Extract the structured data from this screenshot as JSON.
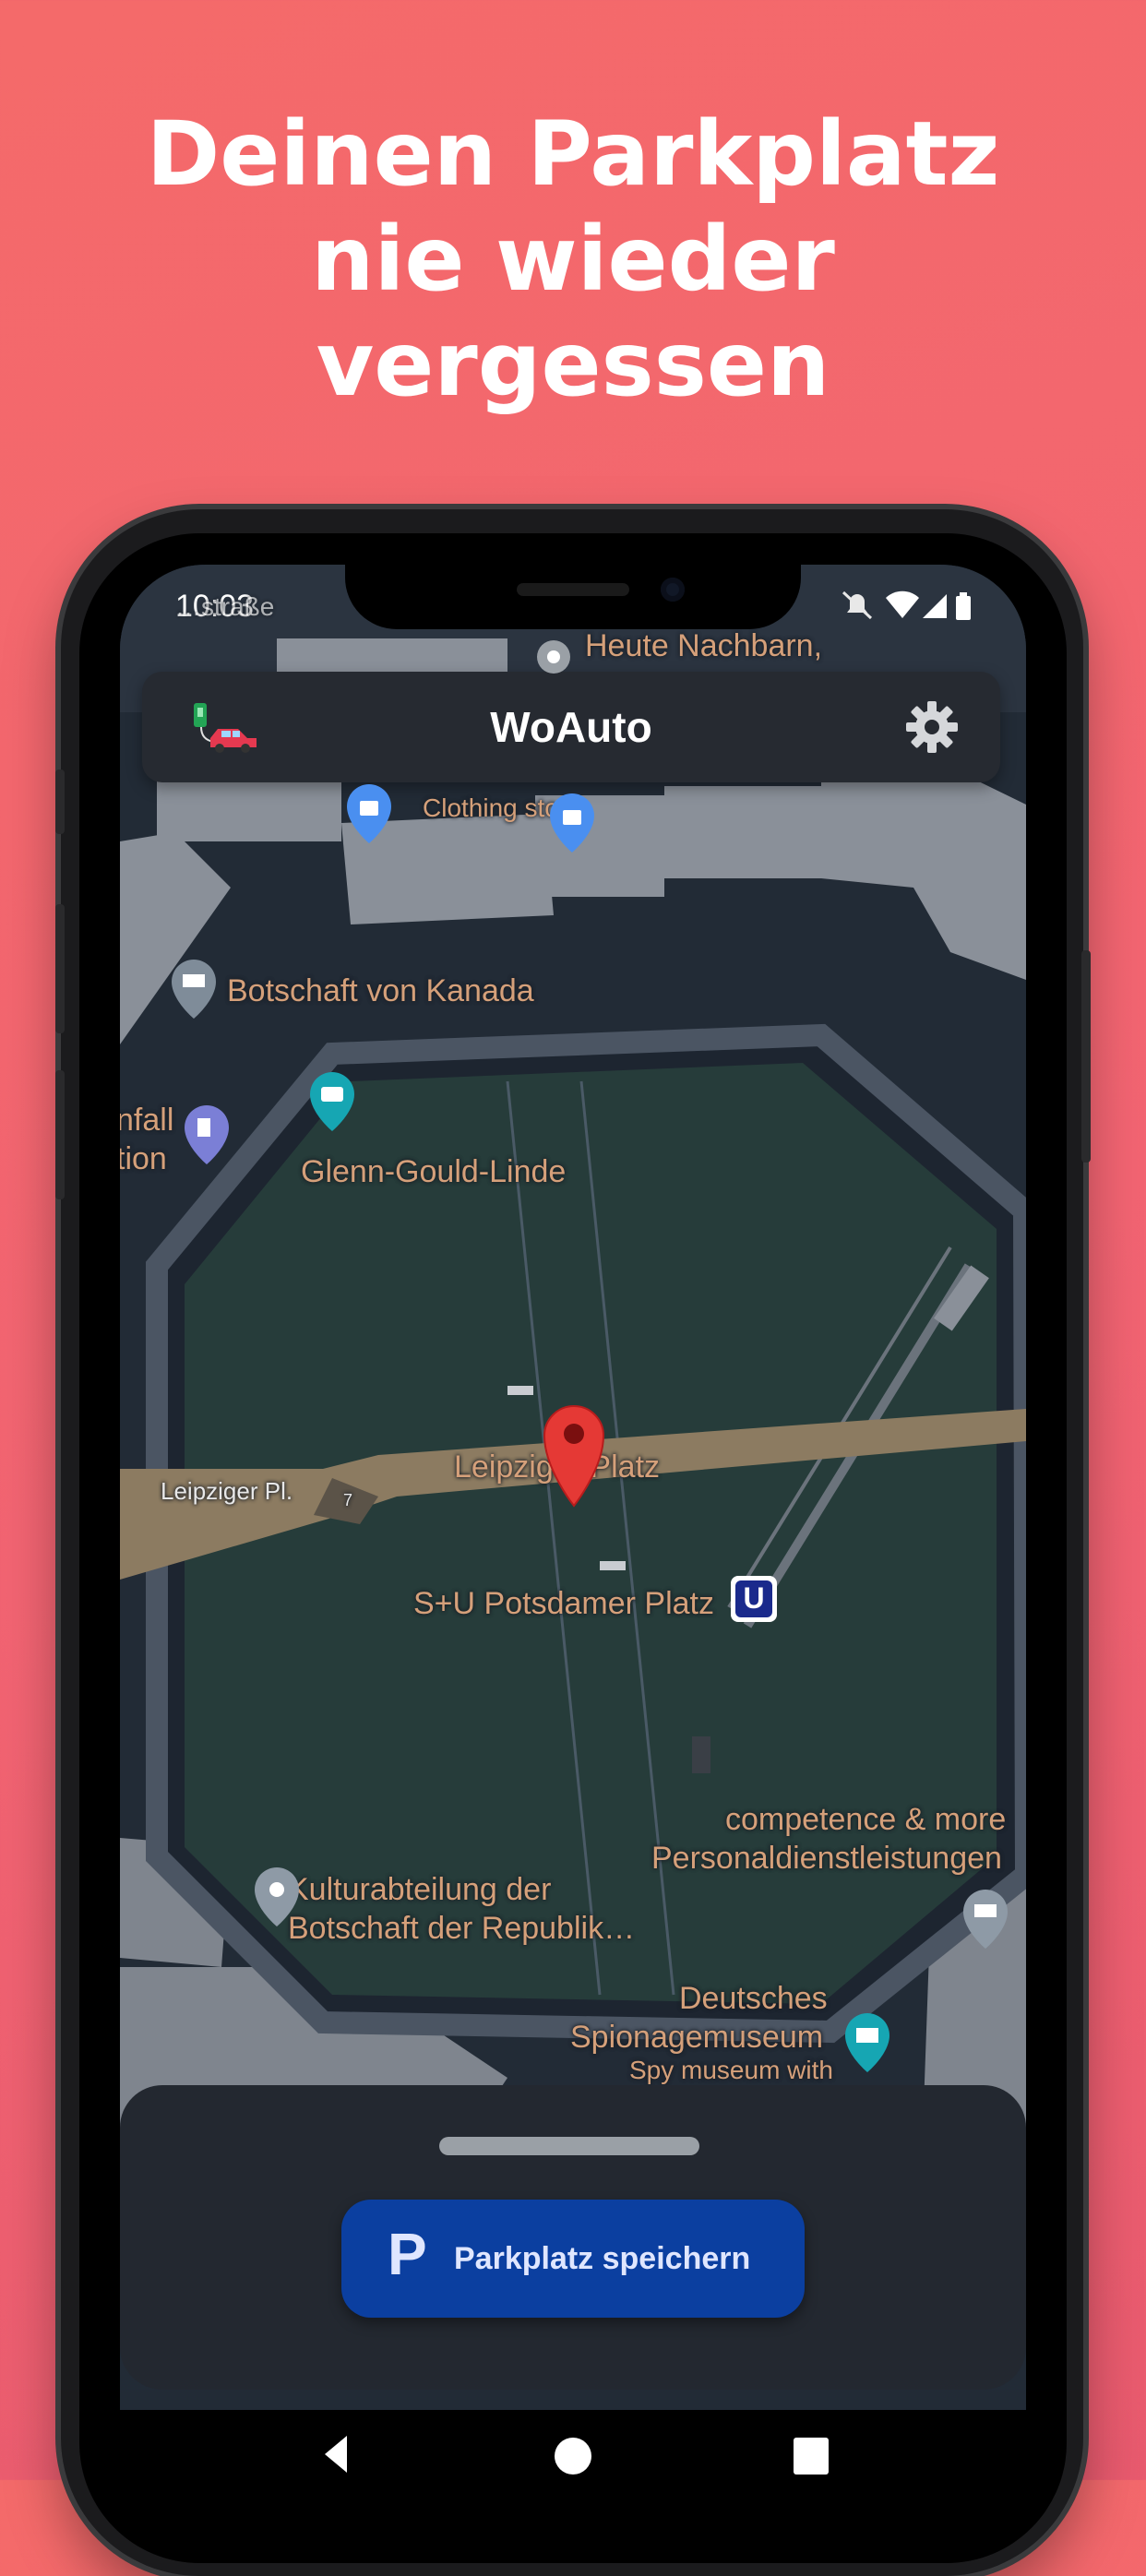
{
  "promo": {
    "headline_lines": [
      "Deinen Parkplatz",
      "nie wieder",
      "vergessen"
    ]
  },
  "status_bar": {
    "time": "10:03",
    "icons": [
      "notifications-off-icon",
      "wifi-icon",
      "signal-icon",
      "battery-icon"
    ]
  },
  "app_bar": {
    "title": "WoAuto",
    "logo_icon": "car-charging-logo-icon",
    "settings_icon": "gear-icon"
  },
  "map": {
    "labels": {
      "street_top": "…straße",
      "heute": "Heute Nachbarn,",
      "clothing": "Clothing store",
      "kanada": "Botschaft von Kanada",
      "fall1": "nfall",
      "fall2": "tion",
      "glenn": "Glenn-Gould-Linde",
      "leipziger_pl": "Leipziger Pl.",
      "road_num": "7",
      "leipziger_platz": "Leipziger Platz",
      "potsdamer": "S+U Potsdamer Platz",
      "competence": "competence & more",
      "personal": "Personaldienstleistungen",
      "kultur1": "Kulturabteilung der",
      "kultur2": "Botschaft der Republik…",
      "deutsches": "Deutsches",
      "spionage": "Spionagemuseum",
      "spy": "Spy museum with"
    },
    "subway_badge": "U"
  },
  "bottom_sheet": {
    "button_icon_letter": "P",
    "button_label": "Parkplatz speichern"
  },
  "colors": {
    "background": "#f26472",
    "accent_button": "#0b3fa0",
    "map_label": "#d5a07a",
    "pin": "#e53935"
  }
}
